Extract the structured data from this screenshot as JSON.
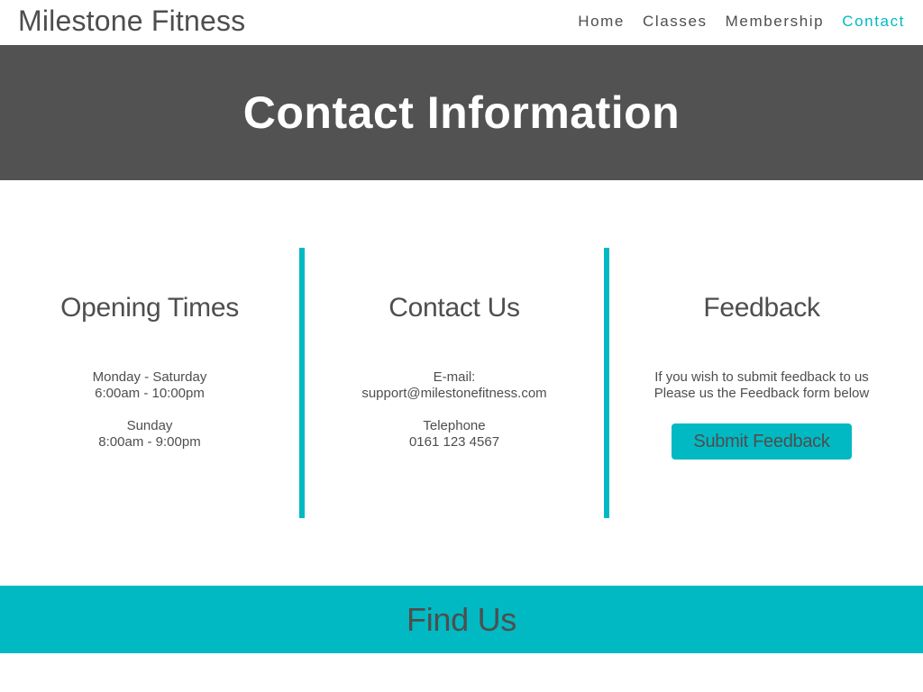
{
  "header": {
    "brand": "Milestone Fitness",
    "nav": [
      {
        "label": "Home",
        "active": false
      },
      {
        "label": "Classes",
        "active": false
      },
      {
        "label": "Membership",
        "active": false
      },
      {
        "label": "Contact",
        "active": true
      }
    ]
  },
  "hero": {
    "title": "Contact Information"
  },
  "columns": {
    "opening": {
      "title": "Opening Times",
      "weekday_label": "Monday - Saturday",
      "weekday_hours": "6:00am - 10:00pm",
      "sunday_label": "Sunday",
      "sunday_hours": "8:00am - 9:00pm"
    },
    "contact": {
      "title": "Contact Us",
      "email_label": "E-mail:",
      "email_value": "support@milestonefitness.com",
      "phone_label": "Telephone",
      "phone_value": "0161 123 4567"
    },
    "feedback": {
      "title": "Feedback",
      "line1": "If you wish to submit feedback to us",
      "line2": "Please us the Feedback form below",
      "button_label": "Submit Feedback"
    }
  },
  "find_us": {
    "title": "Find Us"
  },
  "colors": {
    "accent": "#00b9c3",
    "hero_bg": "#525252",
    "text": "#4e4e4e"
  }
}
